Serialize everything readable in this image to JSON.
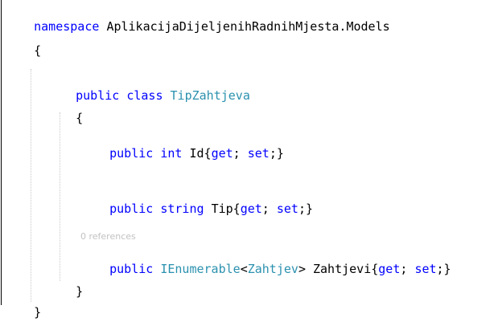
{
  "colors": {
    "keyword": "#0000ff",
    "type": "#2b91af",
    "text": "#000000",
    "codelens": "#c2c2c2",
    "background": "#ffffff"
  },
  "code": {
    "line1": {
      "kw": "namespace",
      "ns": "AplikacijaDijeljenihRadnihMjesta.Models"
    },
    "line2": {
      "brace": "{"
    },
    "line3": {
      "kw_public": "public",
      "kw_class": "class",
      "name": "TipZahtjeva"
    },
    "line4": {
      "brace": "{"
    },
    "line5": {
      "kw_public": "public",
      "kw_type": "int",
      "name": "Id",
      "open": "{",
      "kw_get": "get",
      "semi1": ";",
      "kw_set": "set",
      "close": ";}"
    },
    "line6": {
      "kw_public": "public",
      "kw_type": "string",
      "name": "Tip",
      "open": "{",
      "kw_get": "get",
      "semi1": ";",
      "kw_set": "set",
      "close": ";}"
    },
    "codelens": "0 references",
    "line7": {
      "kw_public": "public",
      "generic": "IEnumerable",
      "lt": "<",
      "type_arg": "Zahtjev",
      "gt": ">",
      "name": "Zahtjevi",
      "open": "{",
      "kw_get": "get",
      "semi1": ";",
      "kw_set": "set",
      "close": ";}"
    },
    "line8": {
      "brace": "}"
    },
    "line9": {
      "brace": "}"
    }
  }
}
